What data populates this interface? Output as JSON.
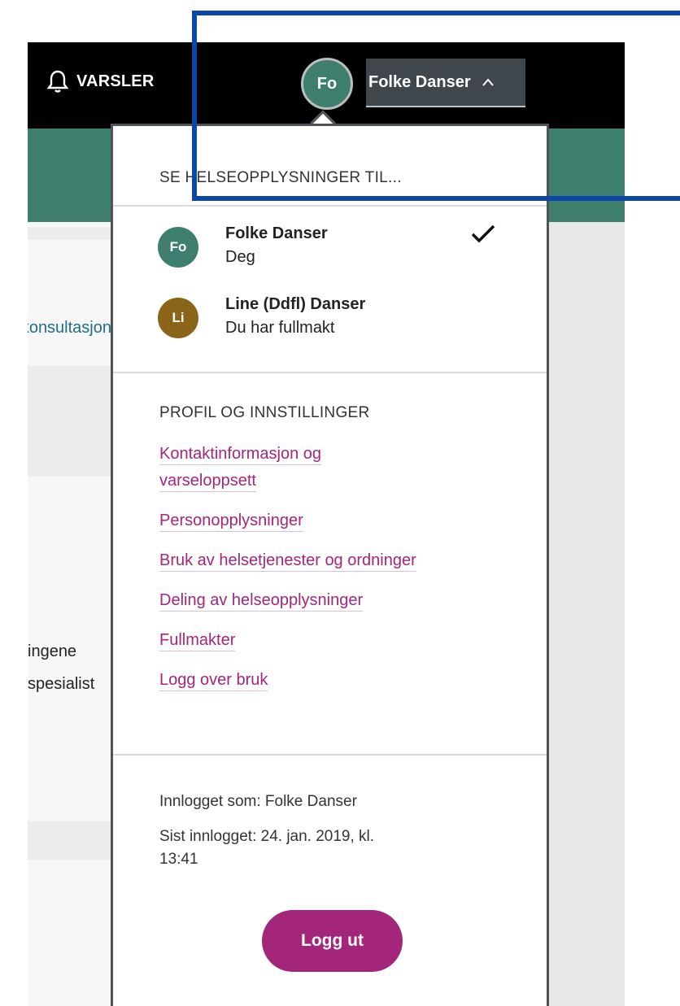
{
  "header": {
    "notifications_label": "VARSLER",
    "user_initials": "Fo",
    "user_name": "Folke Danser"
  },
  "background_page": {
    "link_fragment": "e-konsultasjon",
    "text_line1": "ingene",
    "text_line2": "spesialist"
  },
  "dropdown": {
    "section_people_title": "SE HELSEOPPLYSNINGER TIL...",
    "people": [
      {
        "initials": "Fo",
        "name": "Folke Danser",
        "relation": "Deg",
        "selected": true,
        "color": "#3d7e6e"
      },
      {
        "initials": "Li",
        "name": "Line (Ddfl) Danser",
        "relation": "Du har fullmakt",
        "selected": false,
        "color": "#8a6418"
      }
    ],
    "section_profile_title": "PROFIL OG INNSTILLINGER",
    "links": [
      "Kontaktinformasjon og",
      "varseloppsett",
      "Personopplysninger",
      "Bruk av helsetjenester og ordninger",
      "Deling av helseopplysninger",
      "Fullmakter",
      "Logg over bruk"
    ],
    "logged_in_as": "Innlogget som: Folke Danser",
    "last_login_line1": "Sist innlogget: 24. jan. 2019, kl.",
    "last_login_line2": "13:41",
    "logout_label": "Logg ut"
  },
  "colors": {
    "topbar": "#000000",
    "teal": "#3d7e6e",
    "link_magenta": "#a3267a",
    "annotation_blue": "#0b47a8"
  }
}
